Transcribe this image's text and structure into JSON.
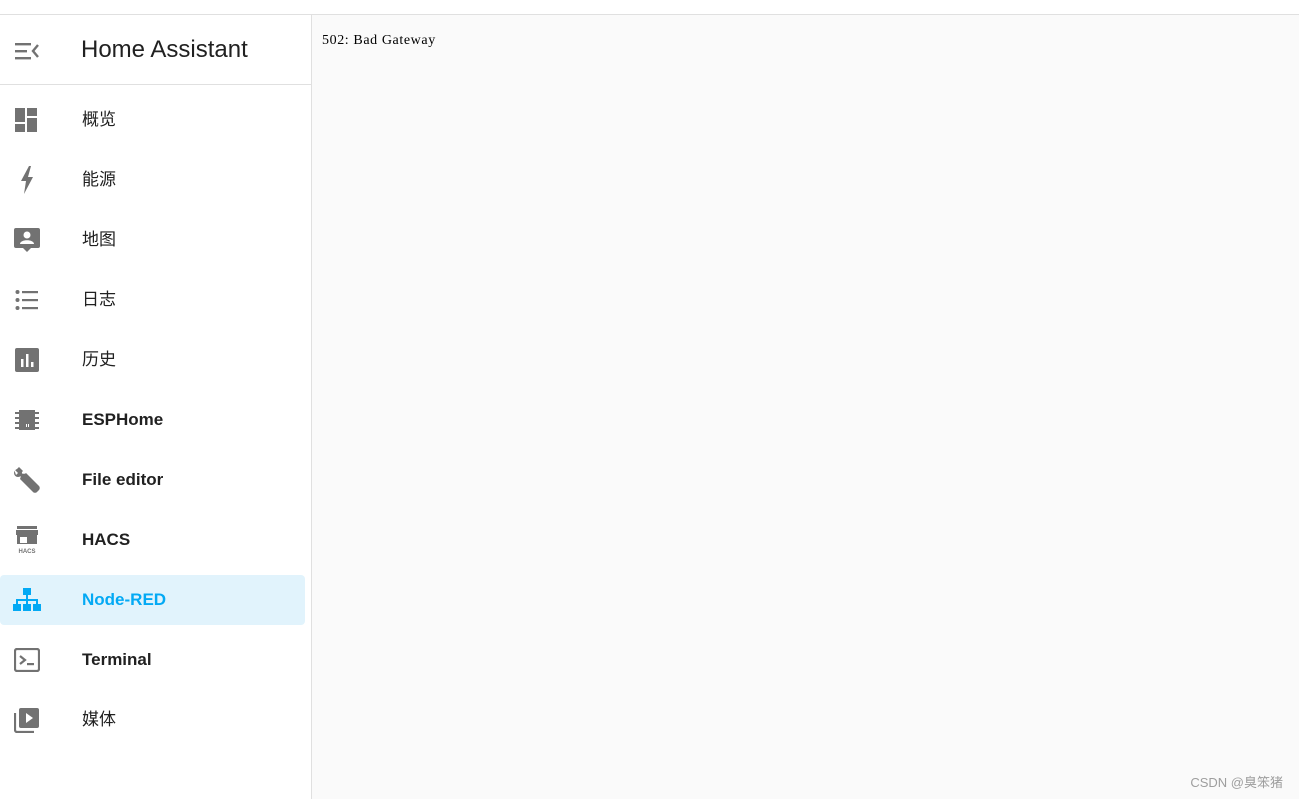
{
  "app": {
    "title": "Home Assistant"
  },
  "sidebar": {
    "items": [
      {
        "label": "概览",
        "icon": "view-dashboard-icon"
      },
      {
        "label": "能源",
        "icon": "lightning-bolt-icon"
      },
      {
        "label": "地图",
        "icon": "account-box-icon"
      },
      {
        "label": "日志",
        "icon": "format-list-bulleted-icon"
      },
      {
        "label": "历史",
        "icon": "chart-box-icon"
      },
      {
        "label": "ESPHome",
        "icon": "chip-icon"
      },
      {
        "label": "File editor",
        "icon": "wrench-icon"
      },
      {
        "label": "HACS",
        "icon": "hacs-store-icon"
      },
      {
        "label": "Node-RED",
        "icon": "sitemap-icon",
        "active": true
      },
      {
        "label": "Terminal",
        "icon": "console-icon"
      },
      {
        "label": "媒体",
        "icon": "play-box-multiple-icon"
      }
    ]
  },
  "main": {
    "error": "502: Bad Gateway"
  },
  "watermark": "CSDN @臭笨猪",
  "colors": {
    "accent": "#03a9f4",
    "active_bg": "#e1f3fc",
    "icon": "#727272",
    "main_bg": "#fafafa"
  }
}
